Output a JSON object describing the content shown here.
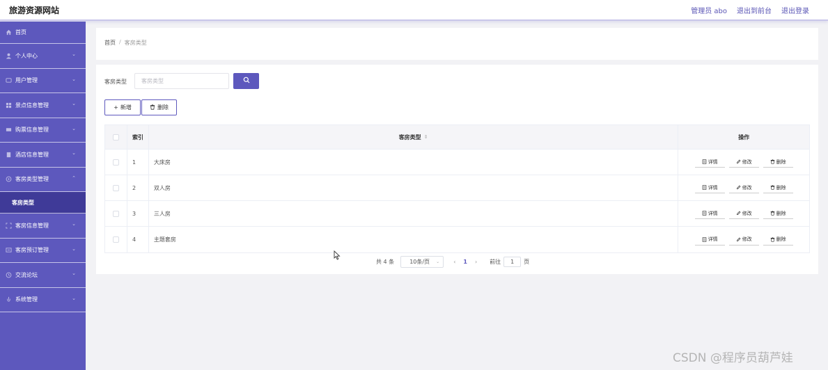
{
  "header": {
    "site_title": "旅游资源网站",
    "admin_label": "管理员 abo",
    "to_frontend": "退出到前台",
    "logout": "退出登录"
  },
  "sidebar": {
    "items": [
      {
        "label": "首页",
        "icon": "home-icon"
      },
      {
        "label": "个人中心",
        "icon": "person-icon"
      },
      {
        "label": "用户管理",
        "icon": "user-icon"
      },
      {
        "label": "景点信息管理",
        "icon": "grid-icon"
      },
      {
        "label": "购票信息管理",
        "icon": "ticket-icon"
      },
      {
        "label": "酒店信息管理",
        "icon": "hotel-icon"
      },
      {
        "label": "客房类型管理",
        "icon": "room-type-icon"
      },
      {
        "label": "客房信息管理",
        "icon": "room-icon"
      },
      {
        "label": "客房预订管理",
        "icon": "booking-icon"
      },
      {
        "label": "交流论坛",
        "icon": "forum-icon"
      },
      {
        "label": "系统管理",
        "icon": "settings-icon"
      }
    ],
    "active_sub": "客房类型"
  },
  "breadcrumb": {
    "home": "首页",
    "sep": "/",
    "current": "客房类型"
  },
  "search": {
    "label": "客房类型",
    "placeholder": "客房类型"
  },
  "toolbar": {
    "add_label": "新增",
    "delete_label": "删除"
  },
  "table": {
    "headers": {
      "index": "索引",
      "type": "客房类型",
      "ops": "操作"
    },
    "rows": [
      {
        "index": "1",
        "type": "大床房"
      },
      {
        "index": "2",
        "type": "双人房"
      },
      {
        "index": "3",
        "type": "三人房"
      },
      {
        "index": "4",
        "type": "主题套房"
      }
    ],
    "ops": {
      "detail": "详情",
      "edit": "修改",
      "delete": "删除"
    }
  },
  "pager": {
    "total": "共 4 条",
    "page_size": "10条/页",
    "current": "1",
    "goto_label": "前往",
    "goto_value": "1",
    "goto_suffix": "页"
  },
  "watermark": "CSDN @程序员葫芦娃",
  "colors": {
    "accent": "#5d58bd",
    "sidebar_active": "#3f3a98"
  }
}
